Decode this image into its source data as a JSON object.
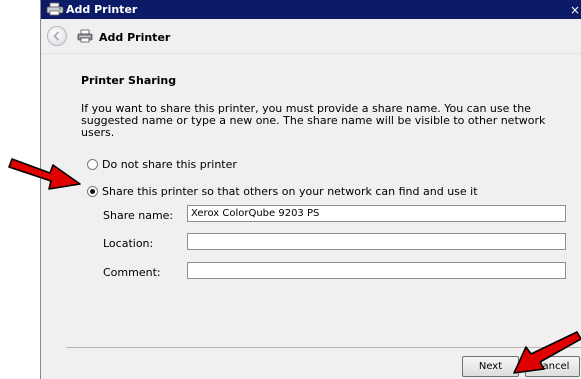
{
  "window": {
    "title": "Add Printer",
    "close_label": "×"
  },
  "nav": {
    "title": "Add Printer"
  },
  "page": {
    "section_title": "Printer Sharing",
    "description": "If you want to share this printer, you must provide a share name. You can use the suggested name or type a new one. The share name will be visible to other network users."
  },
  "options": {
    "do_not_share": {
      "label": "Do not share this printer",
      "checked": false
    },
    "share": {
      "label": "Share this printer so that others on your network can find and use it",
      "checked": true
    }
  },
  "fields": {
    "share_name": {
      "label": "Share name:",
      "value": "Xerox ColorQube 9203 PS"
    },
    "location": {
      "label": "Location:",
      "value": ""
    },
    "comment": {
      "label": "Comment:",
      "value": ""
    }
  },
  "buttons": {
    "next": "Next",
    "cancel": "Cancel"
  },
  "colors": {
    "titlebar": "#0b1b67",
    "annotation_arrow": "#e00000"
  }
}
